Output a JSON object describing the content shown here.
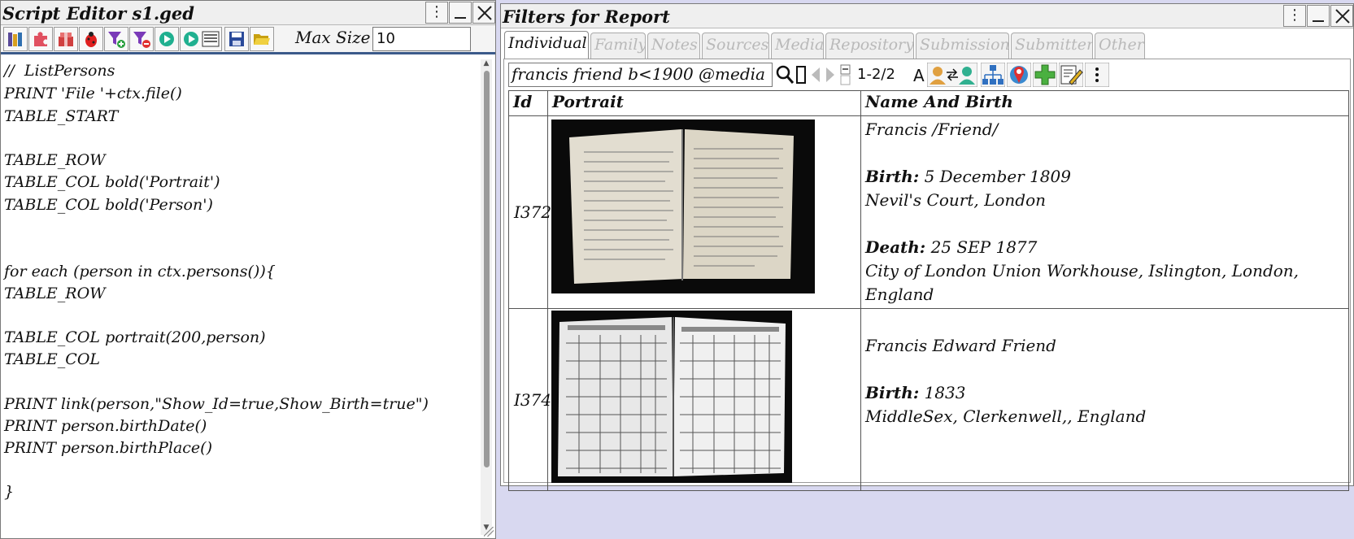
{
  "editor": {
    "title": "Script Editor s1.ged",
    "max_size_label": "Max Size",
    "max_size_value": "10",
    "toolbar_icons": [
      "library-icon",
      "plugin-icon",
      "package-icon",
      "bug-icon",
      "filter-add-icon",
      "filter-remove-icon",
      "run-icon",
      "run-report-icon",
      "save-icon",
      "open-folder-icon"
    ],
    "code_lines": [
      "//  ListPersons",
      "PRINT 'File '+ctx.file()",
      "TABLE_START",
      "",
      "TABLE_ROW",
      "TABLE_COL bold('Portrait')",
      "TABLE_COL bold('Person')",
      "",
      "",
      "for each (person in ctx.persons()){",
      "TABLE_ROW",
      "",
      "TABLE_COL portrait(200,person)",
      "TABLE_COL",
      "",
      "PRINT link(person,\"Show_Id=true,Show_Birth=true\")",
      "PRINT person.birthDate()",
      "PRINT person.birthPlace()",
      "",
      "}"
    ]
  },
  "filters": {
    "title": "Filters for Report",
    "tabs": [
      "Individual",
      "Family",
      "Notes",
      "Sources",
      "Media",
      "Repository",
      "Submission",
      "Submitter",
      "Other"
    ],
    "active_tab": "Individual",
    "search_value": "francis friend b<1900 @media",
    "result_count": "1-2/2",
    "columns": [
      "Id",
      "Portrait",
      "Name And Birth"
    ],
    "rows": [
      {
        "id": "I372",
        "name": "Francis /Friend/",
        "birth_label": "Birth:",
        "birth_date": "5 December 1809",
        "birth_place": "Nevil's Court, London",
        "death_label": "Death:",
        "death_date": "25 SEP 1877",
        "death_place": "City of London Union Workhouse, Islington, London, England"
      },
      {
        "id": "I374",
        "name": "Francis Edward Friend",
        "birth_label": "Birth:",
        "birth_date": "1833",
        "birth_place": "MiddleSex, Clerkenwell,, England"
      }
    ]
  }
}
